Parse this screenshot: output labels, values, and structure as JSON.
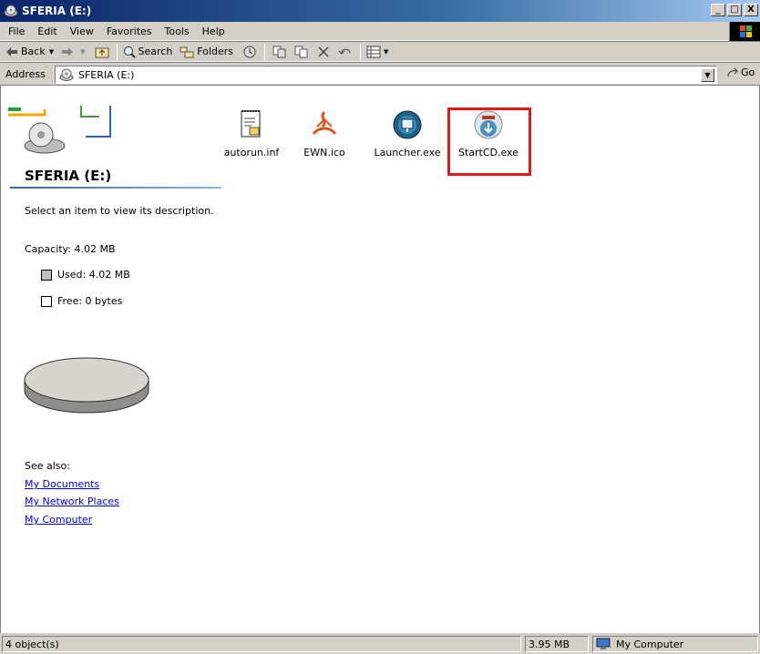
{
  "window": {
    "title": "SFERIA (E:)",
    "minimize": "_",
    "maximize": "□",
    "close": "X"
  },
  "menu": [
    "File",
    "Edit",
    "View",
    "Favorites",
    "Tools",
    "Help"
  ],
  "toolbar": {
    "back": "Back",
    "search": "Search",
    "folders": "Folders"
  },
  "address": {
    "label": "Address",
    "value": "SFERIA (E:)",
    "go": "Go"
  },
  "panel": {
    "title": "SFERIA (E:)",
    "description": "Select an item to view its description.",
    "capacity": "Capacity: 4.02 MB",
    "used": "Used: 4.02 MB",
    "free": "Free: 0 bytes",
    "see_also": "See also:",
    "links": [
      "My Documents",
      "My Network Places",
      "My Computer"
    ]
  },
  "files": [
    {
      "name": "autorun.inf",
      "icon": "text-file-icon"
    },
    {
      "name": "EWN.ico",
      "icon": "ewn-logo-icon"
    },
    {
      "name": "Launcher.exe",
      "icon": "launcher-globe-icon"
    },
    {
      "name": "StartCD.exe",
      "icon": "startcd-icon"
    }
  ],
  "status": {
    "objects": "4 object(s)",
    "size": "3.95 MB",
    "location": "My Computer"
  },
  "colors": {
    "highlight": "#e01b1b",
    "titlebar": "#0a246a",
    "link": "#0000ee"
  }
}
